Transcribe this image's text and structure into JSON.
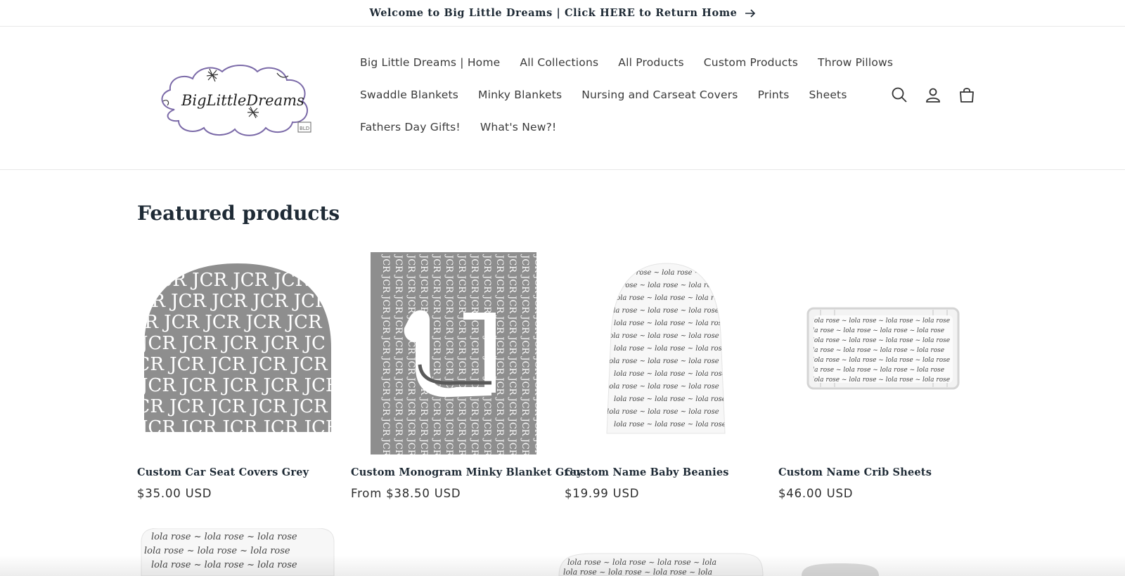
{
  "announcement": {
    "text": "Welcome to Big Little Dreams | Click HERE to Return Home",
    "icon": "arrow-right-icon"
  },
  "header": {
    "logo_alt": "Big Little Dreams",
    "nav": [
      [
        "Big Little Dreams | Home",
        "All Collections",
        "All Products",
        "Custom Products",
        "Throw Pillows"
      ],
      [
        "Swaddle Blankets",
        "Minky Blankets",
        "Nursing and Carseat Covers",
        "Prints",
        "Sheets"
      ],
      [
        "Fathers Day Gifts!",
        "What's New?!"
      ]
    ],
    "icons": [
      "search-icon",
      "account-icon",
      "cart-icon"
    ]
  },
  "featured": {
    "title": "Featured products",
    "products": [
      {
        "title": "Custom Car Seat Covers Grey",
        "price": "$35.00 USD",
        "image_text": "JCR"
      },
      {
        "title": "Custom Monogram Minky Blanket Grey",
        "price": "From $38.50 USD",
        "image_text": "JCR"
      },
      {
        "title": "Custom Name Baby Beanies",
        "price": "$19.99 USD",
        "image_text": "lola rose"
      },
      {
        "title": "Custom Name Crib Sheets",
        "price": "$46.00 USD",
        "image_text": "lola rose"
      }
    ]
  },
  "colors": {
    "heading": "#1e2a35",
    "product_grey": "#8e8e8e",
    "border": "#e8e8e8",
    "logo_purple": "#7b6aa8"
  }
}
